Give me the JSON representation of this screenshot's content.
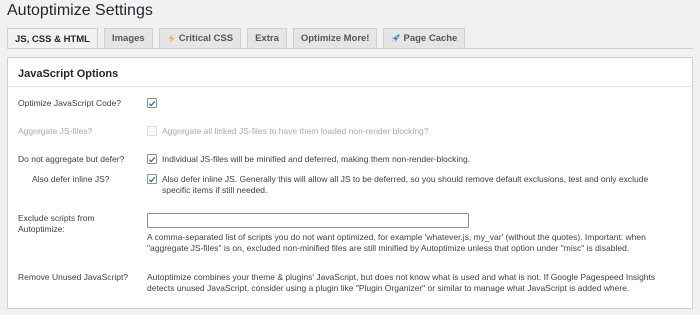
{
  "page": {
    "title": "Autoptimize Settings"
  },
  "tabs": [
    {
      "label": "JS, CSS & HTML",
      "icon": "",
      "active": true
    },
    {
      "label": "Images",
      "icon": "",
      "active": false
    },
    {
      "label": "Critical CSS",
      "icon": "lightning-icon",
      "active": false
    },
    {
      "label": "Extra",
      "icon": "",
      "active": false
    },
    {
      "label": "Optimize More!",
      "icon": "",
      "active": false
    },
    {
      "label": "Page Cache",
      "icon": "rocket-icon",
      "active": false
    }
  ],
  "section": {
    "heading": "JavaScript Options"
  },
  "options": {
    "optimize_js": {
      "label": "Optimize JavaScript Code?",
      "checked": true
    },
    "aggregate": {
      "label": "Aggregate JS-files?",
      "text": "Aggregate all linked JS-files to have them loaded non-render blocking?",
      "checked": false,
      "disabled": true
    },
    "defer": {
      "label": "Do not aggregate but defer?",
      "text": "Individual JS-files will be minified and deferred, making them non-render-blocking.",
      "checked": true
    },
    "defer_inline": {
      "label": "Also defer inline JS?",
      "text": "Also defer inline JS. Generally this will allow all JS to be deferred, so you should remove default exclusions, test and only exclude specific items if still needed.",
      "checked": true
    },
    "exclude": {
      "label": "Exclude scripts from Autoptimize:",
      "value": "",
      "description": "A comma-separated list of scripts you do not want optimized, for example 'whatever.js, my_var' (without the quotes). Important: when \"aggregate JS-files\" is on, excluded non-minified files are still minified by Autoptimize unless that option under \"misc\" is disabled."
    },
    "unused_js": {
      "label": "Remove Unused JavaScript?",
      "text": "Autoptimize combines your theme & plugins' JavaScript, but does not know what is used and what is not. If Google Pagespeed Insights detects unused JavaScript, consider using a plugin like \"Plugin Organizer\" or similar to manage what JavaScript is added where."
    }
  },
  "colors": {
    "checkmark": "#2271b1",
    "lightning": "#f0b849",
    "rocket": "#3582c4"
  }
}
